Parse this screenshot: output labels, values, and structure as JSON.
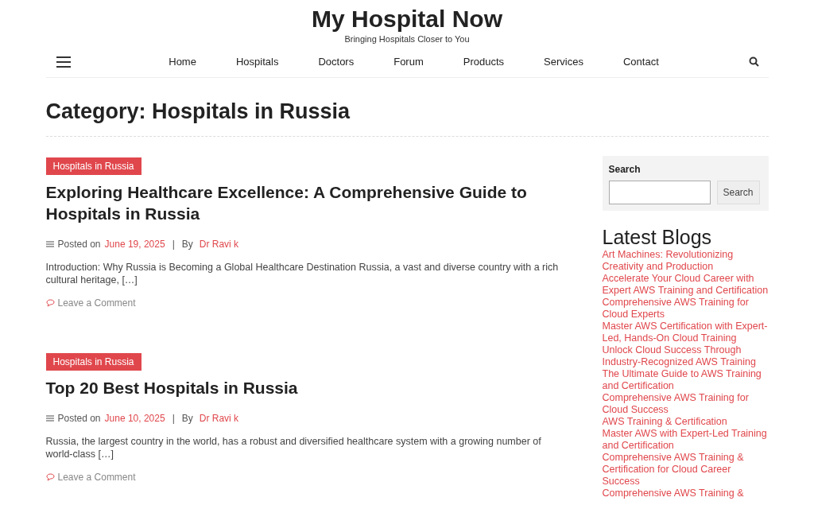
{
  "site": {
    "title": "My Hospital Now",
    "tagline": "Bringing Hospitals Closer to You"
  },
  "nav": [
    "Home",
    "Hospitals",
    "Doctors",
    "Forum",
    "Products",
    "Services",
    "Contact"
  ],
  "page_title": "Category: Hospitals in Russia",
  "posts": [
    {
      "category": "Hospitals in Russia",
      "title": "Exploring Healthcare Excellence: A Comprehensive Guide to Hospitals in Russia",
      "posted_label": "Posted on",
      "date": "June 19, 2025",
      "separator": "|",
      "by_label": "By",
      "author": "Dr Ravi k",
      "excerpt": "Introduction: Why Russia is Becoming a Global Healthcare Destination Russia, a vast and diverse country with a rich cultural heritage, […]",
      "comment_link": "Leave a Comment"
    },
    {
      "category": "Hospitals in Russia",
      "title": "Top 20 Best Hospitals in Russia",
      "posted_label": "Posted on",
      "date": "June 10, 2025",
      "separator": "|",
      "by_label": "By",
      "author": "Dr Ravi k",
      "excerpt": "Russia, the largest country in the world, has a robust and diversified healthcare system with a growing number of world-class […]",
      "comment_link": "Leave a Comment"
    }
  ],
  "sidebar": {
    "search": {
      "label": "Search",
      "button": "Search"
    },
    "latest_blogs": {
      "title": "Latest Blogs",
      "items": [
        "Art Machines: Revolutionizing Creativity and Production",
        "Accelerate Your Cloud Career with Expert AWS Training and Certification",
        "Comprehensive AWS Training for Cloud Experts",
        "Master AWS Certification with Expert-Led, Hands-On Cloud Training",
        "Unlock Cloud Success Through Industry-Recognized AWS Training",
        "The Ultimate Guide to AWS Training and Certification",
        "Comprehensive AWS Training for Cloud Success",
        "AWS Training & Certification",
        "Master AWS with Expert-Led Training and Certification",
        "Comprehensive AWS Training & Certification for Cloud Career Success",
        "Comprehensive AWS Training &"
      ]
    }
  }
}
